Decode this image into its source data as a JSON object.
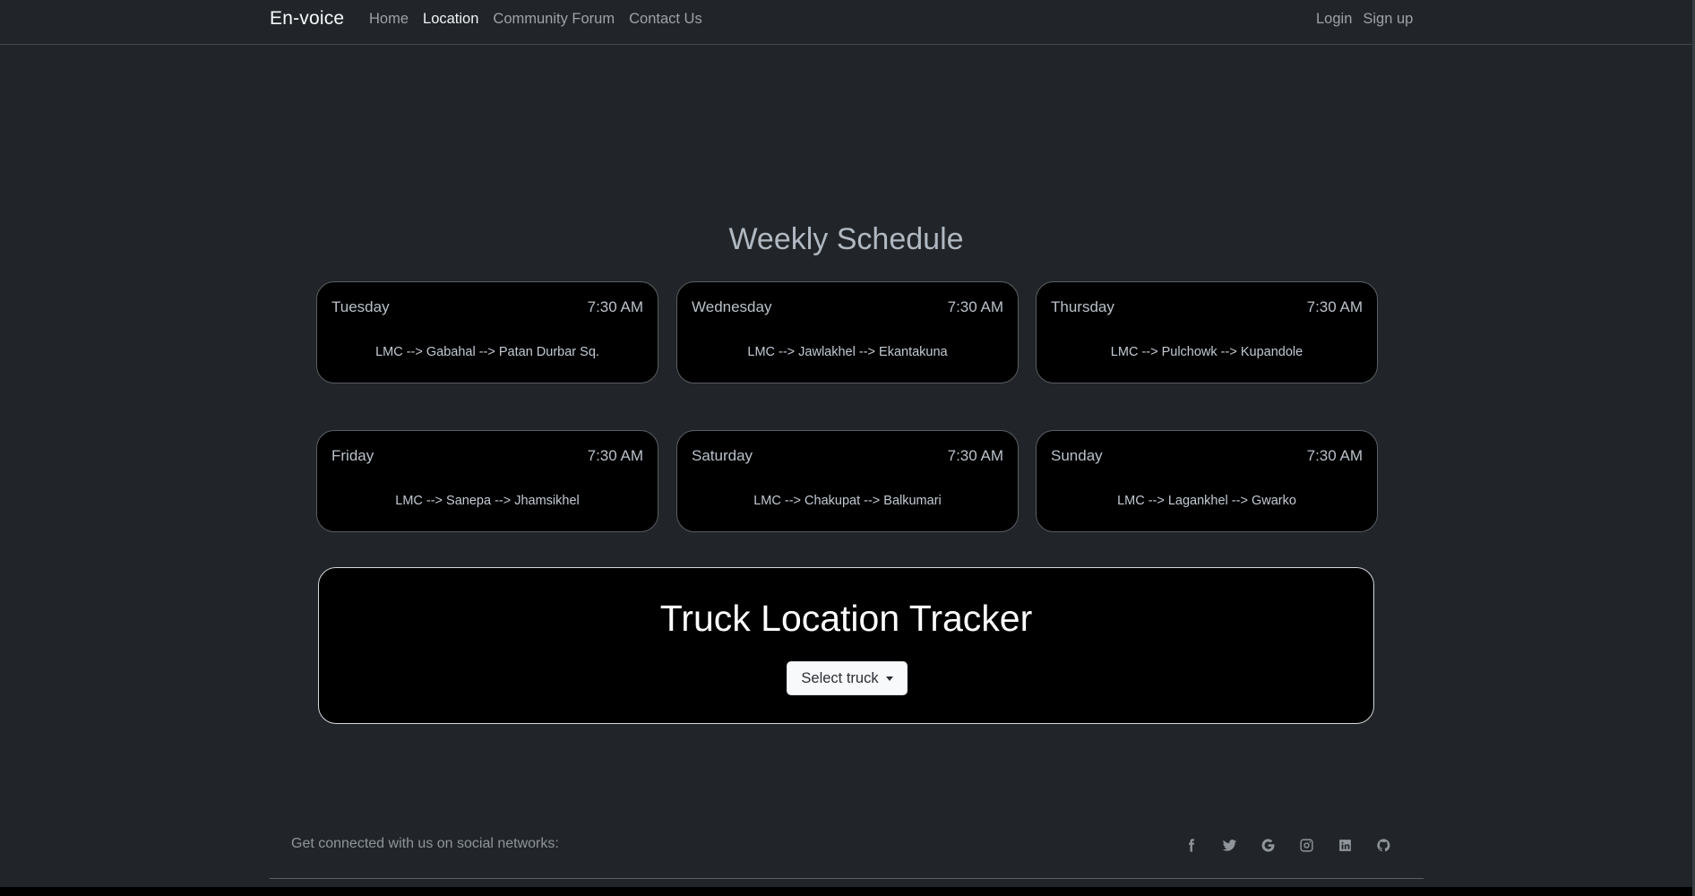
{
  "navbar": {
    "brand": "En-voice",
    "links": [
      {
        "label": "Home",
        "active": false
      },
      {
        "label": "Location",
        "active": true
      },
      {
        "label": "Community Forum",
        "active": false
      },
      {
        "label": "Contact Us",
        "active": false
      }
    ],
    "auth": {
      "login": "Login",
      "signup": "Sign up"
    }
  },
  "schedule": {
    "title": "Weekly Schedule",
    "cards": [
      {
        "day": "Tuesday",
        "time": "7:30 AM",
        "route": "LMC --> Gabahal --> Patan Durbar Sq."
      },
      {
        "day": "Wednesday",
        "time": "7:30 AM",
        "route": "LMC --> Jawlakhel --> Ekantakuna"
      },
      {
        "day": "Thursday",
        "time": "7:30 AM",
        "route": "LMC --> Pulchowk --> Kupandole"
      },
      {
        "day": "Friday",
        "time": "7:30 AM",
        "route": "LMC --> Sanepa --> Jhamsikhel"
      },
      {
        "day": "Saturday",
        "time": "7:30 AM",
        "route": "LMC --> Chakupat --> Balkumari"
      },
      {
        "day": "Sunday",
        "time": "7:30 AM",
        "route": "LMC --> Lagankhel --> Gwarko"
      }
    ]
  },
  "tracker": {
    "title": "Truck Location Tracker",
    "select_label": "Select truck"
  },
  "footer": {
    "text": "Get connected with us on social networks:",
    "social_icons": [
      "facebook-icon",
      "twitter-icon",
      "google-icon",
      "instagram-icon",
      "linkedin-icon",
      "github-icon"
    ]
  },
  "colors": {
    "background": "#212529",
    "card_background": "#000000",
    "text_muted": "#adb5bd",
    "button_light": "#f8f9fa"
  }
}
